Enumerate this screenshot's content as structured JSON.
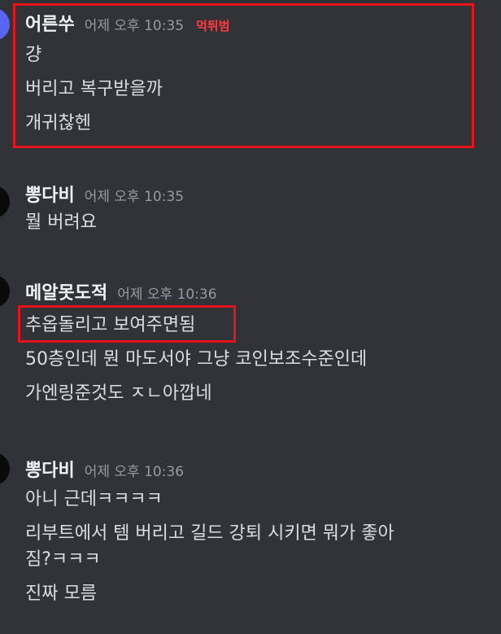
{
  "messages": [
    {
      "author": "어른쑤",
      "time": "어제 오후 10:35",
      "tag": "먹튀범",
      "lines": [
        "걍",
        "버리고 복구받을까",
        "개귀찮헨"
      ]
    },
    {
      "author": "뽕다비",
      "time": "어제 오후 10:35",
      "lines": [
        "뭘 버려요"
      ]
    },
    {
      "author": "메알못도적",
      "time": "어제 오후 10:36",
      "lines": [
        "추옵돌리고 보여주면됨",
        "50층인데 뭔 마도서야 그냥 코인보조수준인데",
        "가엔링준것도 ㅈㄴ아깝네"
      ]
    },
    {
      "author": "뽕다비",
      "time": "어제 오후 10:36",
      "lines": [
        "아니 근데ㅋㅋㅋㅋ",
        "리부트에서 템 버리고 길드 강퇴 시키면 뭐가 좋아",
        "짐?ㅋㅋㅋ",
        "진짜 모름"
      ]
    }
  ]
}
